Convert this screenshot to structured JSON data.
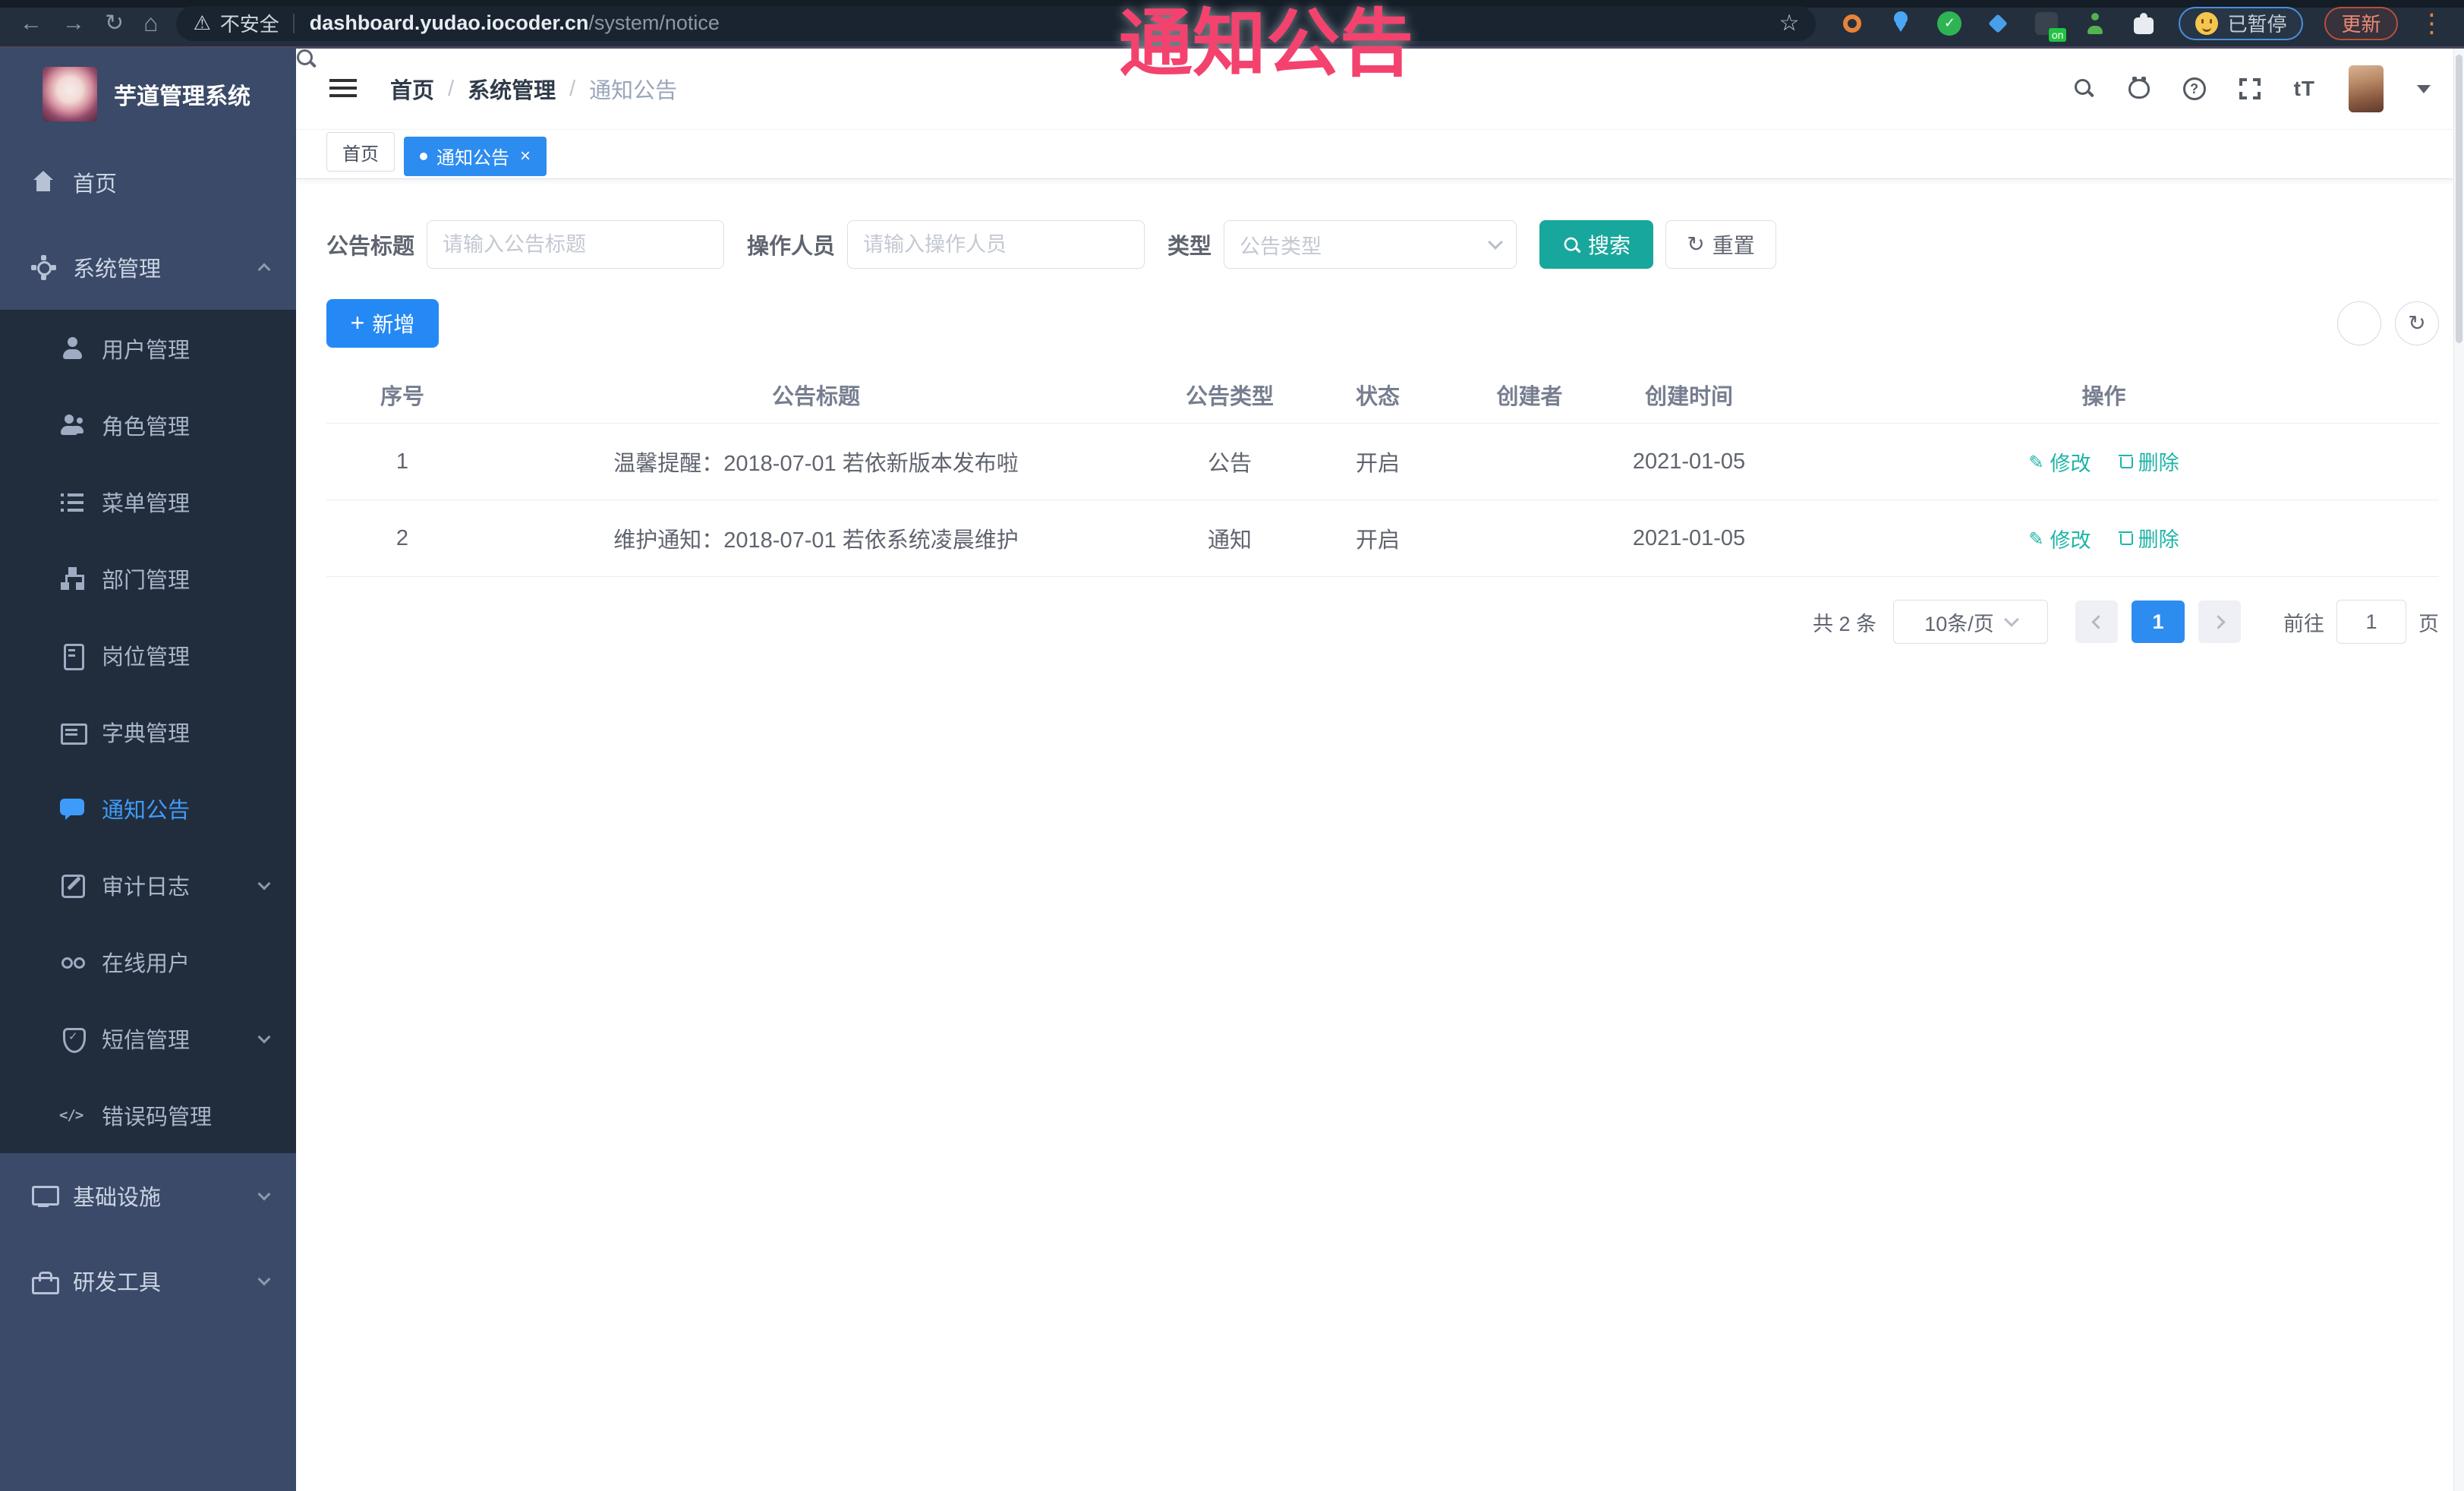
{
  "browser": {
    "security": "不安全",
    "url_host": "dashboard.yudao.iocoder.cn",
    "url_path": "/system/notice",
    "paused": "已暂停",
    "update": "更新",
    "on_badge": "on"
  },
  "watermark": "通知公告",
  "sidebar": {
    "title": "芋道管理系统",
    "items": [
      {
        "key": "home",
        "label": "首页",
        "icon": "home",
        "level": "root"
      },
      {
        "key": "system-management",
        "label": "系统管理",
        "icon": "gear",
        "level": "root",
        "chevron": "up"
      },
      {
        "key": "user-management",
        "label": "用户管理",
        "icon": "user",
        "level": "sub"
      },
      {
        "key": "role-management",
        "label": "角色管理",
        "icon": "users",
        "level": "sub"
      },
      {
        "key": "menu-management",
        "label": "菜单管理",
        "icon": "list",
        "level": "sub"
      },
      {
        "key": "dept-management",
        "label": "部门管理",
        "icon": "org",
        "level": "sub"
      },
      {
        "key": "post-management",
        "label": "岗位管理",
        "icon": "badge",
        "level": "sub"
      },
      {
        "key": "dict-management",
        "label": "字典管理",
        "icon": "book",
        "level": "sub"
      },
      {
        "key": "notice-announcement",
        "label": "通知公告",
        "icon": "bubble",
        "level": "sub",
        "active": true
      },
      {
        "key": "audit-log",
        "label": "审计日志",
        "icon": "pencil",
        "level": "sub",
        "chevron": "down"
      },
      {
        "key": "online-users",
        "label": "在线用户",
        "icon": "online",
        "level": "sub"
      },
      {
        "key": "sms-management",
        "label": "短信管理",
        "icon": "shield",
        "level": "sub",
        "chevron": "down"
      },
      {
        "key": "error-code-management",
        "label": "错误码管理",
        "icon": "code",
        "level": "sub"
      },
      {
        "key": "infrastructure",
        "label": "基础设施",
        "icon": "monitor",
        "level": "root",
        "chevron": "down"
      },
      {
        "key": "dev-tools",
        "label": "研发工具",
        "icon": "toolbox",
        "level": "root",
        "chevron": "down"
      }
    ]
  },
  "header": {
    "breadcrumb": [
      "首页",
      "系统管理",
      "通知公告"
    ]
  },
  "tabs": [
    {
      "label": "首页",
      "active": false
    },
    {
      "label": "通知公告",
      "active": true
    }
  ],
  "filters": {
    "title_label": "公告标题",
    "title_placeholder": "请输入公告标题",
    "operator_label": "操作人员",
    "operator_placeholder": "请输入操作人员",
    "type_label": "类型",
    "type_placeholder": "公告类型",
    "search_label": "搜索",
    "reset_label": "重置"
  },
  "toolbar": {
    "add_label": "新增"
  },
  "table": {
    "columns": [
      "序号",
      "公告标题",
      "公告类型",
      "状态",
      "创建者",
      "创建时间",
      "操作"
    ],
    "edit_label": "修改",
    "delete_label": "删除",
    "rows": [
      {
        "no": "1",
        "title": "温馨提醒：2018-07-01 若依新版本发布啦",
        "type": "公告",
        "status": "开启",
        "creator": "",
        "created": "2021-01-05"
      },
      {
        "no": "2",
        "title": "维护通知：2018-07-01 若依系统凌晨维护",
        "type": "通知",
        "status": "开启",
        "creator": "",
        "created": "2021-01-05"
      }
    ]
  },
  "pagination": {
    "total": "共 2 条",
    "page_size": "10条/页",
    "current_page": "1",
    "goto_label": "前往",
    "goto_value": "1",
    "page_unit": "页"
  },
  "colors": {
    "primary_blue": "#2d8cf0",
    "teal_button": "#18a79c",
    "link_teal": "#1db5a7",
    "annotation_pink": "#f4426f",
    "sidebar_bg": "#3a4a68",
    "submenu_bg": "#212d3d"
  }
}
